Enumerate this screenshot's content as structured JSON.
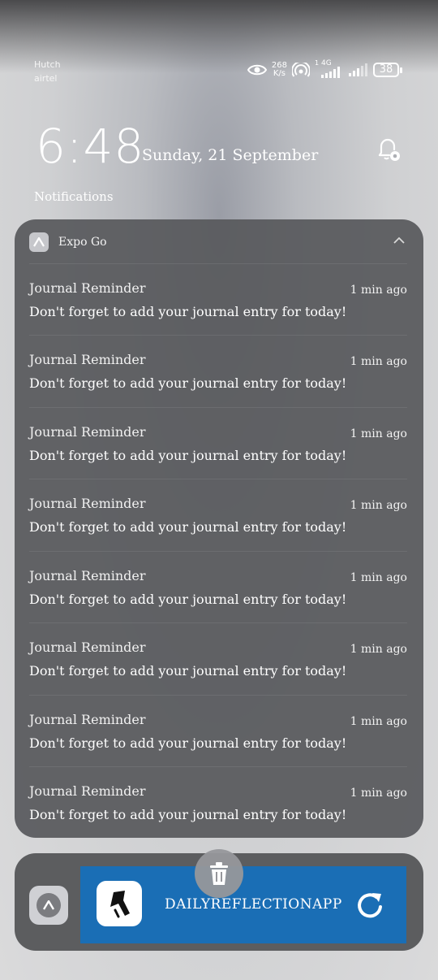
{
  "status_bar": {
    "carrier_1": "Hutch",
    "carrier_2": "airtel",
    "speed_value": "268",
    "speed_unit": "K/s",
    "network_type": "4G",
    "sim_index": "1",
    "battery": "38"
  },
  "lockscreen": {
    "time": "6:48",
    "date": "Sunday, 21 September",
    "section_label": "Notifications"
  },
  "notification_group": {
    "app_name": "Expo Go",
    "items": [
      {
        "title": "Journal Reminder",
        "time": "1 min ago",
        "body": "Don't forget to add your journal entry for today!"
      },
      {
        "title": "Journal Reminder",
        "time": "1 min ago",
        "body": "Don't forget to add your journal entry for today!"
      },
      {
        "title": "Journal Reminder",
        "time": "1 min ago",
        "body": "Don't forget to add your journal entry for today!"
      },
      {
        "title": "Journal Reminder",
        "time": "1 min ago",
        "body": "Don't forget to add your journal entry for today!"
      },
      {
        "title": "Journal Reminder",
        "time": "1 min ago",
        "body": "Don't forget to add your journal entry for today!"
      },
      {
        "title": "Journal Reminder",
        "time": "1 min ago",
        "body": "Don't forget to add your journal entry for today!"
      },
      {
        "title": "Journal Reminder",
        "time": "1 min ago",
        "body": "Don't forget to add your journal entry for today!"
      },
      {
        "title": "Journal Reminder",
        "time": "1 min ago",
        "body": "Don't forget to add your journal entry for today!"
      }
    ]
  },
  "running_app": {
    "label": "DAILYREFLECTIONAPP",
    "accent_color": "#1a6eb5"
  },
  "icons": [
    "eye-icon",
    "hotspot-icon",
    "signal-icon",
    "battery-icon",
    "notification-settings-icon",
    "expo-icon",
    "chevron-up-icon",
    "trash-icon",
    "refresh-icon"
  ]
}
